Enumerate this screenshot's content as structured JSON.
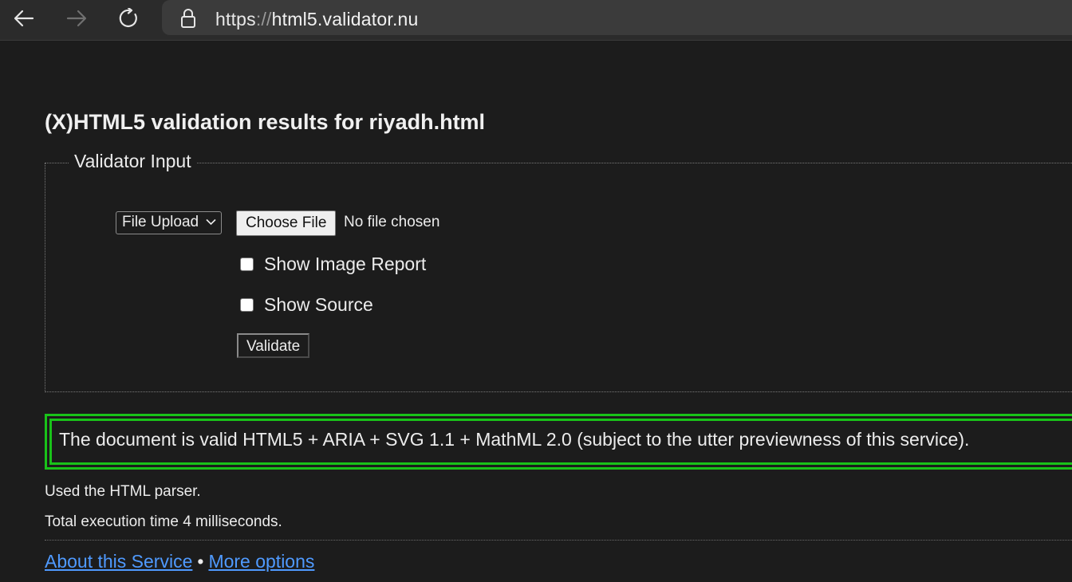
{
  "browser": {
    "back_icon": "arrow-left-icon",
    "forward_icon": "arrow-right-icon",
    "reload_icon": "refresh-icon",
    "lock_icon": "lock-icon",
    "url_scheme": "https",
    "url_separator": "://",
    "url_host": "html5.validator.nu"
  },
  "page": {
    "title": "(X)HTML5 validation results for riyadh.html",
    "input_section": {
      "legend": "Validator Input",
      "mode_select": "File Upload",
      "choose_file_label": "Choose File",
      "file_status": "No file chosen",
      "show_image_report_label": "Show Image Report",
      "show_image_report_checked": false,
      "show_source_label": "Show Source",
      "show_source_checked": false,
      "validate_label": "Validate"
    },
    "result": {
      "message": "The document is valid HTML5 + ARIA + SVG 1.1 + MathML 2.0 (subject to the utter previewness of this service).",
      "color": "#19c219"
    },
    "parser_info": "Used the HTML parser.",
    "execution_time": "Total execution time 4 milliseconds.",
    "footer": {
      "about_link": "About this Service",
      "separator": "•",
      "more_options_link": "More options"
    }
  }
}
